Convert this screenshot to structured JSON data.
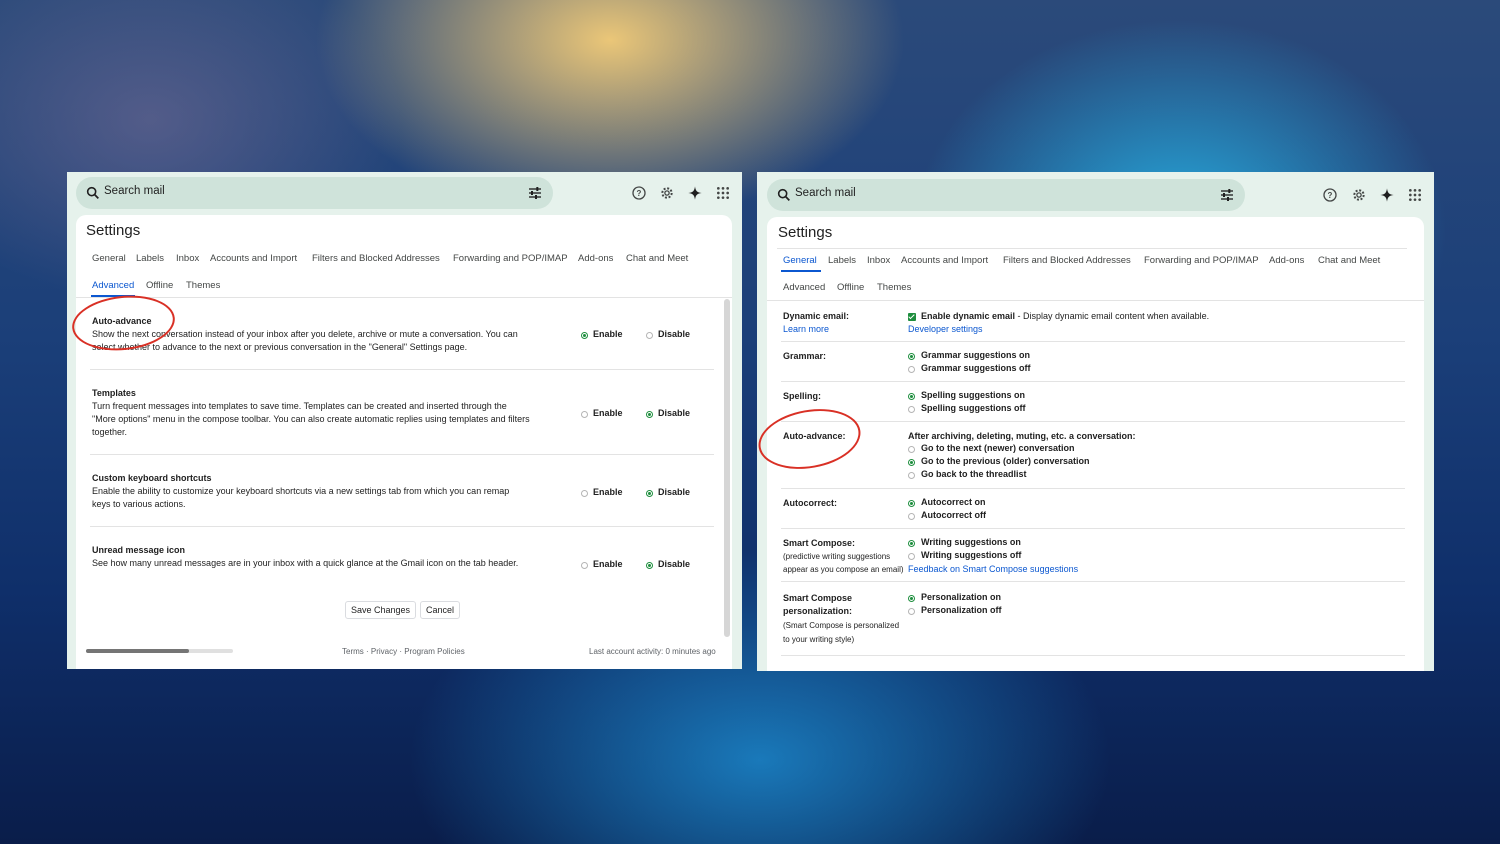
{
  "left": {
    "search_placeholder": "Search mail",
    "title": "Settings",
    "tabs_row1": [
      "General",
      "Labels",
      "Inbox",
      "Accounts and Import",
      "Filters and Blocked Addresses",
      "Forwarding and POP/IMAP",
      "Add-ons",
      "Chat and Meet"
    ],
    "tabs_row2": [
      "Advanced",
      "Offline",
      "Themes"
    ],
    "active_tab": "Advanced",
    "settings": [
      {
        "name": "Auto-advance",
        "desc": "Show the next conversation instead of your inbox after you delete, archive or mute a conversation. You can select whether to advance to the next or previous conversation in the \"General\" Settings page.",
        "enable": "Enable",
        "disable": "Disable",
        "selected": "Enable"
      },
      {
        "name": "Templates",
        "desc": "Turn frequent messages into templates to save time. Templates can be created and inserted through the \"More options\" menu in the compose toolbar. You can also create automatic replies using templates and filters together.",
        "enable": "Enable",
        "disable": "Disable",
        "selected": "Disable"
      },
      {
        "name": "Custom keyboard shortcuts",
        "desc": "Enable the ability to customize your keyboard shortcuts via a new settings tab from which you can remap keys to various actions.",
        "enable": "Enable",
        "disable": "Disable",
        "selected": "Disable"
      },
      {
        "name": "Unread message icon",
        "desc": "See how many unread messages are in your inbox with a quick glance at the Gmail icon on the tab header.",
        "enable": "Enable",
        "disable": "Disable",
        "selected": "Disable"
      }
    ],
    "save_label": "Save Changes",
    "cancel_label": "Cancel",
    "footer_links": "Terms · Privacy · Program Policies",
    "footer_activity": "Last account activity: 0 minutes ago",
    "horizontal_scroll_position": 0.7
  },
  "right": {
    "search_placeholder": "Search mail",
    "title": "Settings",
    "tabs_row1": [
      "General",
      "Labels",
      "Inbox",
      "Accounts and Import",
      "Filters and Blocked Addresses",
      "Forwarding and POP/IMAP",
      "Add-ons",
      "Chat and Meet"
    ],
    "tabs_row2": [
      "Advanced",
      "Offline",
      "Themes"
    ],
    "active_tab": "General",
    "dynamic_email": {
      "label": "Dynamic email:",
      "learn_more": "Learn more",
      "option_bold": "Enable dynamic email",
      "option_rest": " - Display dynamic email content when available.",
      "developer": "Developer settings"
    },
    "grammar": {
      "label": "Grammar:",
      "options": [
        "Grammar suggestions on",
        "Grammar suggestions off"
      ],
      "selected": 0
    },
    "spelling": {
      "label": "Spelling:",
      "options": [
        "Spelling suggestions on",
        "Spelling suggestions off"
      ],
      "selected": 0
    },
    "auto_advance": {
      "label": "Auto-advance:",
      "heading": "After archiving, deleting, muting, etc. a conversation:",
      "options": [
        "Go to the next (newer) conversation",
        "Go to the previous (older) conversation",
        "Go back to the threadlist"
      ],
      "selected": 1
    },
    "autocorrect": {
      "label": "Autocorrect:",
      "options": [
        "Autocorrect on",
        "Autocorrect off"
      ],
      "selected": 0
    },
    "smart_compose": {
      "label": "Smart Compose:",
      "sub1": "(predictive writing suggestions",
      "sub2": "appear as you compose an email)",
      "options": [
        "Writing suggestions on",
        "Writing suggestions off"
      ],
      "selected": 0,
      "feedback": "Feedback on Smart Compose suggestions"
    },
    "personalization": {
      "label1": "Smart Compose",
      "label2": "personalization:",
      "sub1": "(Smart Compose is personalized",
      "sub2": "to your writing style)",
      "options": [
        "Personalization on",
        "Personalization off"
      ],
      "selected": 0
    }
  },
  "colors": {
    "accent": "#0b57d0",
    "green": "#1e8e3e",
    "annotation": "#d93025",
    "panel_bg": "#e6f2ec",
    "search_bg": "#cfe3da"
  },
  "icons": [
    "search-icon",
    "tune-icon",
    "help-icon",
    "gear-icon",
    "gemini-icon",
    "apps-icon"
  ]
}
